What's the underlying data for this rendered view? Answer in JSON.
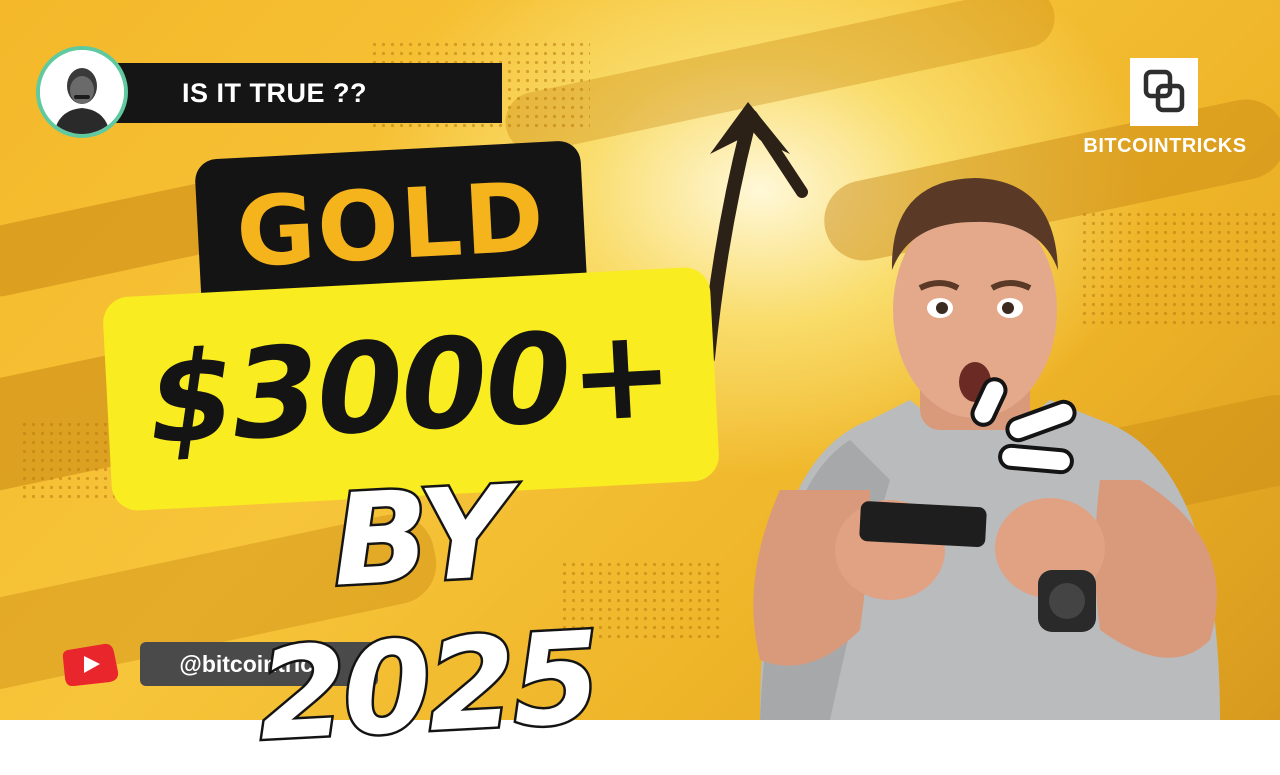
{
  "badge": {
    "text": "IS IT TRUE ??"
  },
  "headline": {
    "line1": "GOLD",
    "line2": "$3000+",
    "line3": "BY 2025"
  },
  "brand": {
    "name": "BITCOINTRICKS",
    "logo_icon": "overlapping-squares-icon"
  },
  "channel": {
    "handle": "@bitcointricks",
    "icon": "youtube-icon"
  },
  "colors": {
    "background": "#f4b82a",
    "gold_text": "#f5b31c",
    "price_box": "#f9ec20",
    "dark": "#141414",
    "avatar_ring": "#5fc9a0",
    "youtube_red": "#e8262b"
  }
}
